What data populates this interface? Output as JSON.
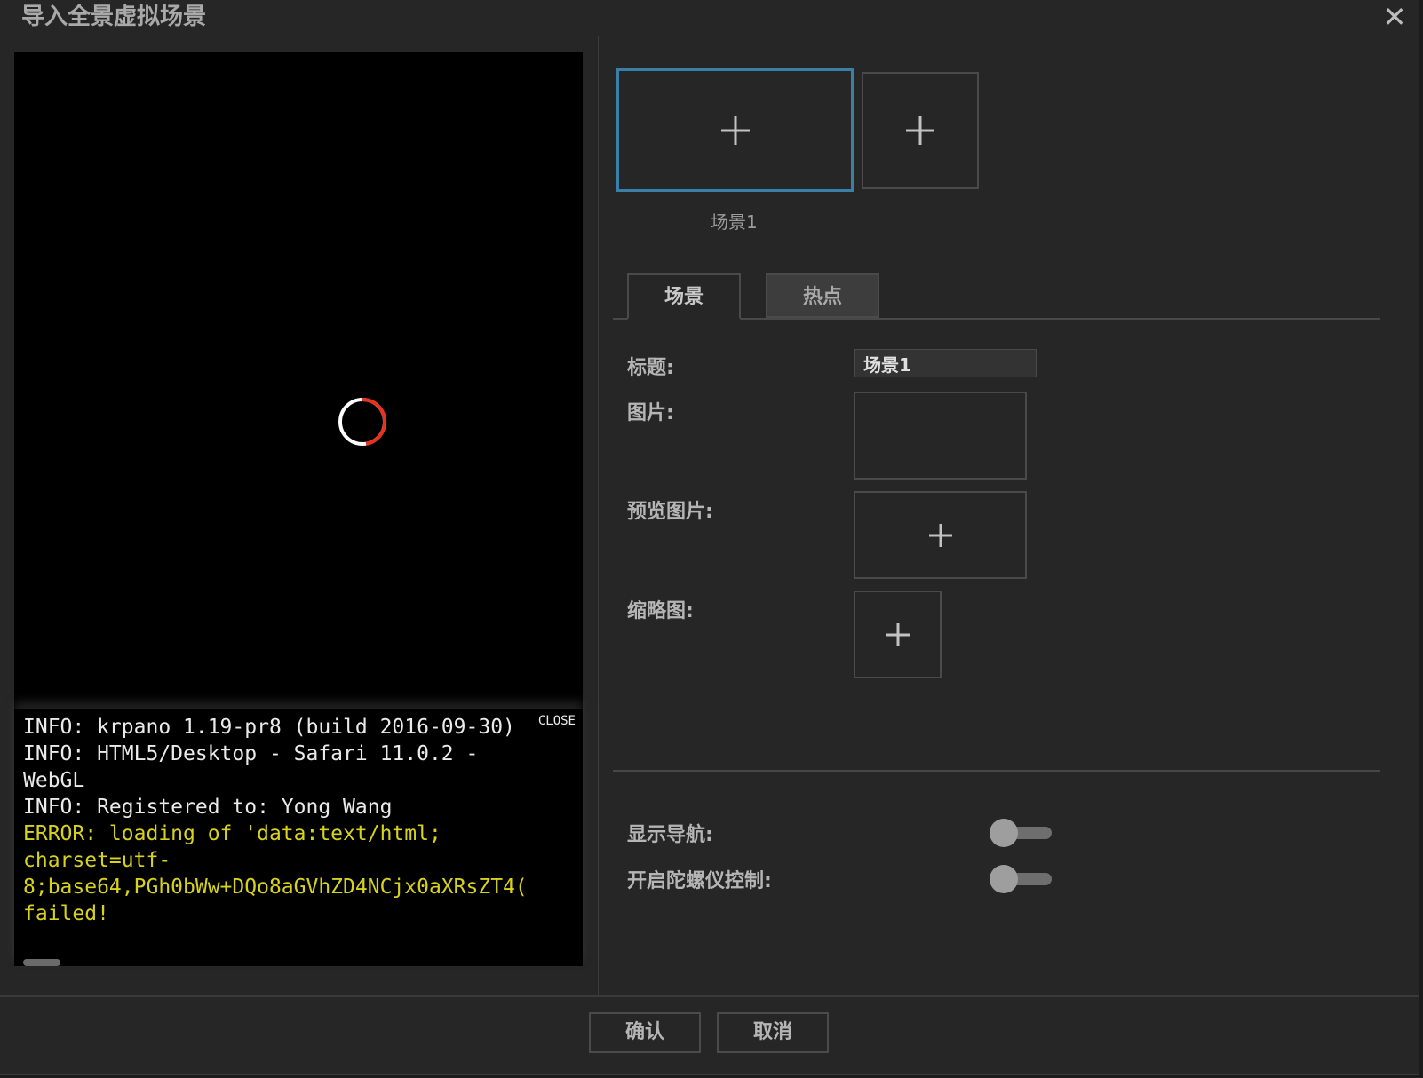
{
  "dialog": {
    "title": "导入全景虚拟场景",
    "close_icon": "close-icon"
  },
  "console": {
    "close_label": "CLOSE",
    "lines": [
      {
        "text": "INFO: krpano 1.19-pr8 (build 2016-09-30)",
        "level": "info"
      },
      {
        "text": "INFO: HTML5/Desktop - Safari 11.0.2 -",
        "level": "info"
      },
      {
        "text": "WebGL",
        "level": "info"
      },
      {
        "text": "INFO: Registered to: Yong Wang",
        "level": "info"
      },
      {
        "text": "ERROR: loading of 'data:text/html;",
        "level": "error"
      },
      {
        "text": "charset=utf-",
        "level": "error"
      },
      {
        "text": "8;base64,PGh0bWw+DQo8aGVhZD4NCjx0aXRsZT4(",
        "level": "error"
      },
      {
        "text": "failed!",
        "level": "error"
      }
    ],
    "error_color": "#d7d21d",
    "info_color": "#eaeaea"
  },
  "scenes": {
    "caption": "场景1",
    "active_border_color": "#3a7fa8"
  },
  "tabs": [
    {
      "label": "场景",
      "active": true
    },
    {
      "label": "热点",
      "active": false
    }
  ],
  "form": {
    "title_label": "标题:",
    "title_value": "场景1",
    "image_label": "图片:",
    "preview_label": "预览图片:",
    "thumbnail_label": "缩略图:"
  },
  "settings": {
    "nav_label": "显示导航:",
    "nav_on": false,
    "gyro_label": "开启陀螺仪控制:",
    "gyro_on": false
  },
  "footer": {
    "confirm_label": "确认",
    "cancel_label": "取消"
  }
}
